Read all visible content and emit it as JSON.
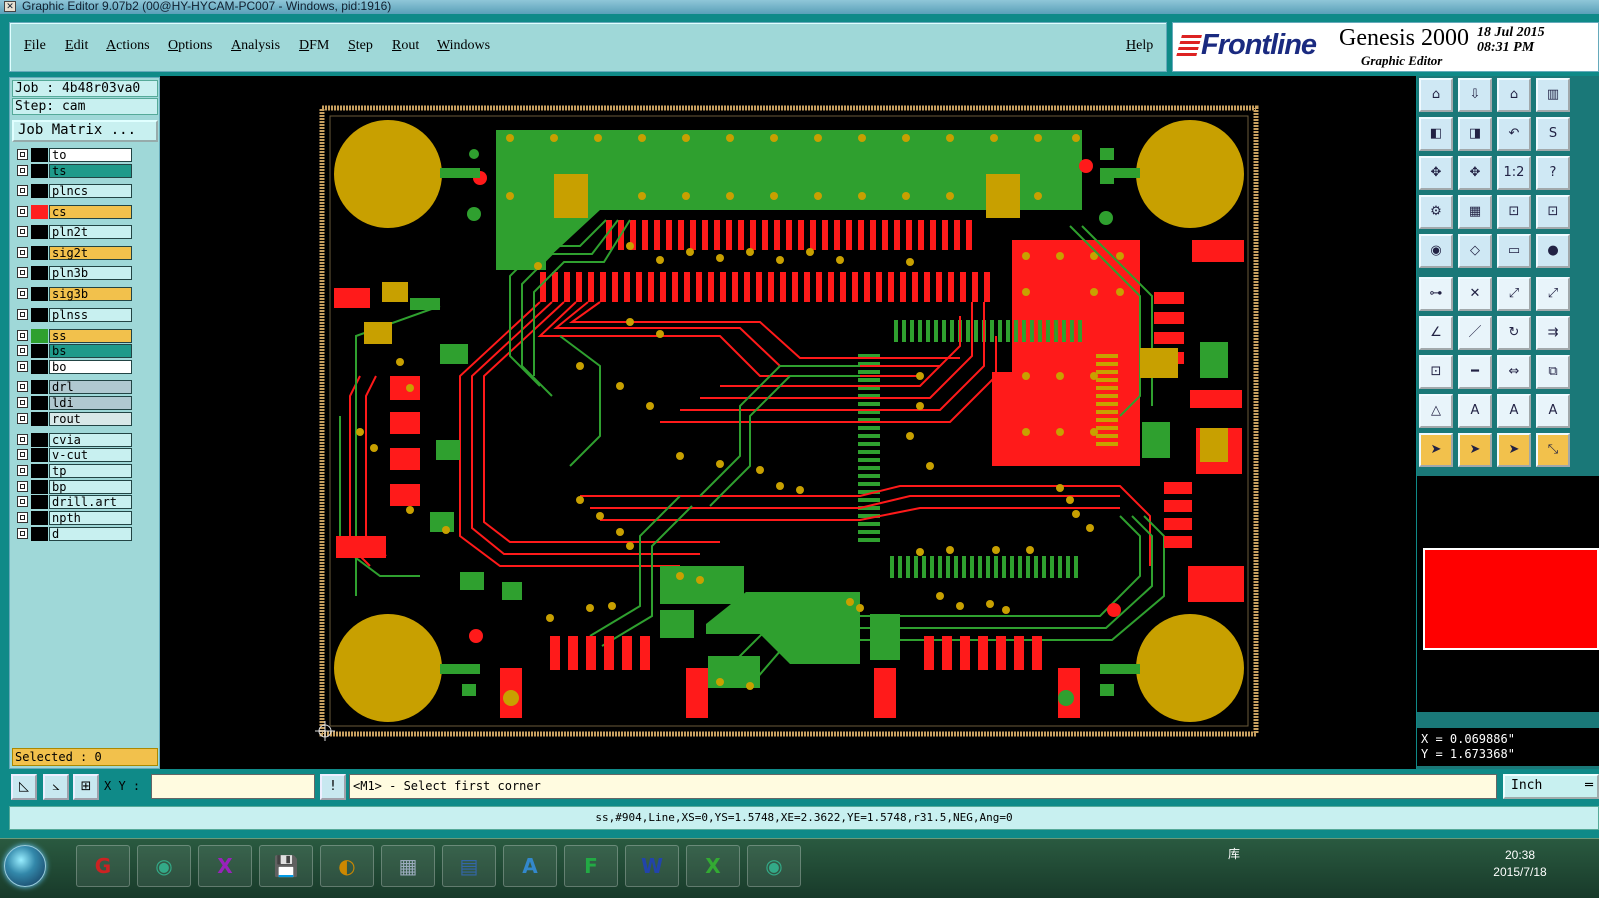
{
  "window": {
    "title": "Graphic Editor 9.07b2 (00@HY-HYCAM-PC007 - Windows, pid:1916)"
  },
  "menu": {
    "items": [
      "File",
      "Edit",
      "Actions",
      "Options",
      "Analysis",
      "DFM",
      "Step",
      "Rout",
      "Windows"
    ],
    "help": "Help"
  },
  "brand": {
    "logo": "Frontline",
    "product": "Genesis 2000",
    "subtitle": "Graphic Editor",
    "date": "18 Jul 2015",
    "time": "08:31 PM"
  },
  "job": {
    "job_label": "Job : 4b48r03va0",
    "step_label": "Step: cam",
    "job_matrix": "Job Matrix ..."
  },
  "layers": [
    {
      "name": "to",
      "color": "#ffffff",
      "swatch": "#000000",
      "mark": "✎"
    },
    {
      "name": "ts",
      "color": "#1f9a8a",
      "swatch": "#000000",
      "mark": ""
    },
    {
      "name": "plncs",
      "color": "#c8f0f0",
      "swatch": "#000000",
      "mark": ""
    },
    {
      "name": "cs",
      "color": "#f2c14c",
      "swatch": "#ff2020",
      "mark": ""
    },
    {
      "name": "pln2t",
      "color": "#c8f0f0",
      "swatch": "#000000",
      "mark": ""
    },
    {
      "name": "sig2t",
      "color": "#f2c14c",
      "swatch": "#000000",
      "mark": ""
    },
    {
      "name": "pln3b",
      "color": "#c8f0f0",
      "swatch": "#000000",
      "mark": ""
    },
    {
      "name": "sig3b",
      "color": "#f2c14c",
      "swatch": "#000000",
      "mark": ""
    },
    {
      "name": "plnss",
      "color": "#c8f0f0",
      "swatch": "#000000",
      "mark": ""
    },
    {
      "name": "ss",
      "color": "#f2c14c",
      "swatch": "#2fa02f",
      "mark": "■"
    },
    {
      "name": "bs",
      "color": "#1f9a8a",
      "swatch": "#000000",
      "mark": ""
    },
    {
      "name": "bo",
      "color": "#ffffff",
      "swatch": "#000000",
      "mark": "✎"
    },
    {
      "name": "drl",
      "color": "#b0c8d0",
      "swatch": "#000000",
      "mark": ""
    },
    {
      "name": "ldi",
      "color": "#b0c8d0",
      "swatch": "#000000",
      "mark": ""
    },
    {
      "name": "rout",
      "color": "#d8e8e8",
      "swatch": "#000000",
      "mark": ""
    },
    {
      "name": "cvia",
      "color": "#c8f0f0",
      "swatch": "#000000",
      "mark": ""
    },
    {
      "name": "v-cut",
      "color": "#c8f0f0",
      "swatch": "#000000",
      "mark": ""
    },
    {
      "name": "tp",
      "color": "#c8f0f0",
      "swatch": "#000000",
      "mark": ""
    },
    {
      "name": "bp",
      "color": "#c8f0f0",
      "swatch": "#000000",
      "mark": ""
    },
    {
      "name": "drill.art",
      "color": "#c8f0f0",
      "swatch": "#000000",
      "mark": ""
    },
    {
      "name": "npth",
      "color": "#c8f0f0",
      "swatch": "#000000",
      "mark": ""
    },
    {
      "name": "d",
      "color": "#c8f0f0",
      "swatch": "#000000",
      "mark": ""
    }
  ],
  "selected": "Selected : 0",
  "cmd": {
    "xy_label": "X Y :",
    "xy_value": "",
    "prompt": "<M1> - Select first corner",
    "units": "Inch"
  },
  "coords": {
    "x": "X = 0.069886\"",
    "y": "Y = 1.673368\""
  },
  "status": "ss,#904,Line,XS=0,YS=1.5748,XE=2.3622,YE=1.5748,r31.5,NEG,Ang=0",
  "tools": [
    "home-icon",
    "zoom-home-icon",
    "redraw-icon",
    "split-view-icon",
    "pan-left-icon",
    "pan-right-icon",
    "undo-icon",
    "snap-icon",
    "zoom-fit-icon",
    "zoom-center-icon",
    "scale-1to1-icon",
    "help-icon",
    "wrench-icon",
    "grid-icon",
    "layer-compare-icon",
    "layer-pair-icon",
    "camera-icon",
    "measure-icon",
    "ruler-icon",
    "pad-icon",
    "connect-icon",
    "cross-icon",
    "route-icon",
    "line-add-icon",
    "angle-icon",
    "line-edit-icon",
    "arc-icon",
    "feature-icon",
    "net-icon",
    "minus-icon",
    "move-icon",
    "copy-icon",
    "triangle-icon",
    "text-a-icon",
    "text-a-alt-icon",
    "text-a2-icon",
    "pointer-icon",
    "select-icon",
    "select-box-icon",
    "select-net-icon"
  ],
  "taskbar": {
    "apps": [
      "G",
      "◉",
      "X",
      "💾",
      "◐",
      "▦",
      "▤",
      "A",
      "F",
      "W",
      "X",
      "◉"
    ],
    "tray": "库",
    "time": "20:38",
    "date": "2015/7/18"
  },
  "colors": {
    "copper_top": "#ff1a1a",
    "copper_bot": "#2fa02f",
    "overlap": "#c8a000",
    "panel": "#9fd8d8",
    "accent": "#f2c14c"
  }
}
